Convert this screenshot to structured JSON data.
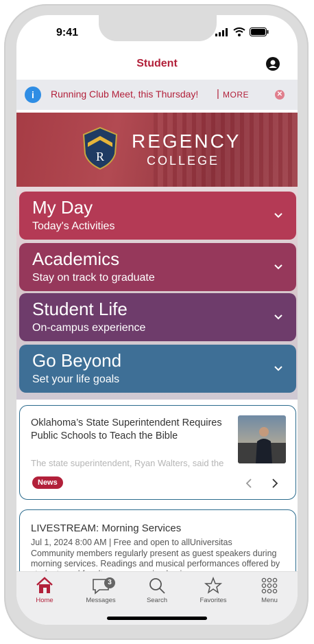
{
  "status_bar": {
    "time": "9:41"
  },
  "header": {
    "title": "Student"
  },
  "alert": {
    "text": "Running Club Meet, this Thursday!",
    "separator": "|",
    "more_label": "MORE"
  },
  "brand": {
    "crest_letter": "R",
    "name": "REGENCY",
    "subtitle": "COLLEGE"
  },
  "cards": [
    {
      "title": "My Day",
      "subtitle": "Today's Activities",
      "color": "#b43a55"
    },
    {
      "title": "Academics",
      "subtitle": "Stay on track to graduate",
      "color": "#96385b"
    },
    {
      "title": "Student Life",
      "subtitle": "On-campus experience",
      "color": "#6e3c6b"
    },
    {
      "title": "Go Beyond",
      "subtitle": "Set your life goals",
      "color": "#3e6f96"
    }
  ],
  "news": {
    "headline": "Oklahoma’s State Superintendent Requires Public Schools to Teach the Bible",
    "snippet": "The state superintendent, Ryan Walters, said the",
    "badge": "News"
  },
  "livestream": {
    "title": "LIVESTREAM: Morning Services",
    "meta": "Jul 1, 2024 8:00 AM | Free and open to allUniversitas",
    "description": "Community members regularly present as guest speakers during morning services. Readings and musical performances offered by students and faculty on an ongoing basis."
  },
  "tabs": [
    {
      "label": "Home",
      "icon": "home-icon",
      "active": true
    },
    {
      "label": "Messages",
      "icon": "messages-icon",
      "badge": "3"
    },
    {
      "label": "Search",
      "icon": "search-icon"
    },
    {
      "label": "Favorites",
      "icon": "star-icon"
    },
    {
      "label": "Menu",
      "icon": "grid-menu-icon"
    }
  ],
  "colors": {
    "accent": "#b2203a",
    "info": "#2f8de4",
    "card_border": "#2a6a8c"
  }
}
